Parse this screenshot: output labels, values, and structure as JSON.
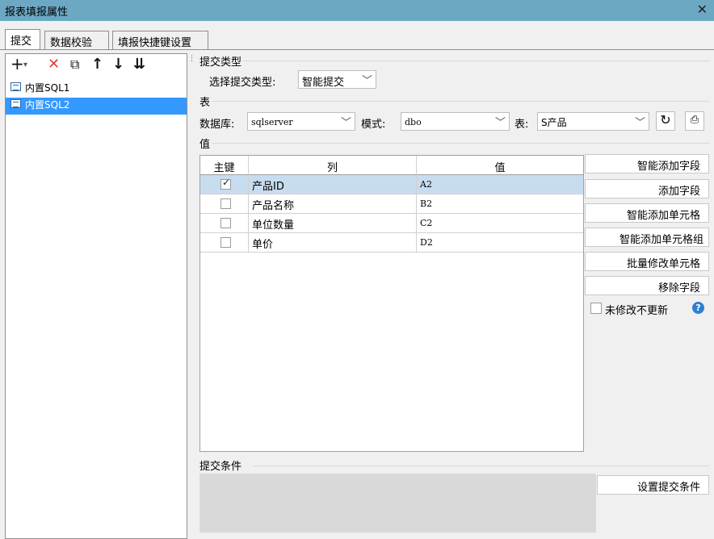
{
  "window": {
    "title": "报表填报属性",
    "close_glyph": "✕"
  },
  "tabs": [
    {
      "label": "提交"
    },
    {
      "label": "数据校验"
    },
    {
      "label": "填报快捷键设置"
    }
  ],
  "toolbar": {
    "add_glyph": "+",
    "add_dropdown_glyph": "▾",
    "delete_glyph": "✕",
    "copy_glyph": "⧉",
    "up_glyph": "↑",
    "down_glyph": "↓",
    "move_glyph": "⇊"
  },
  "tree": {
    "items": [
      {
        "label": "内置SQL1",
        "selected": false
      },
      {
        "label": "内置SQL2",
        "selected": true
      }
    ]
  },
  "submit_type": {
    "group_label": "提交类型",
    "select_label": "选择提交类型:",
    "selected": "智能提交"
  },
  "table_group": {
    "group_label": "表",
    "database_label": "数据库:",
    "database_value": "sqlserver",
    "schema_label": "模式:",
    "schema_value": "dbo",
    "table_label": "表:",
    "table_value": "S产品"
  },
  "values_group": {
    "group_label": "值",
    "columns": [
      "主键",
      "列",
      "值"
    ],
    "rows": [
      {
        "key": true,
        "column": "产品ID",
        "value": "A2",
        "selected": true
      },
      {
        "key": false,
        "column": "产品名称",
        "value": "B2",
        "selected": false
      },
      {
        "key": false,
        "column": "单位数量",
        "value": "C2",
        "selected": false
      },
      {
        "key": false,
        "column": "单价",
        "value": "D2",
        "selected": false
      }
    ]
  },
  "side_buttons": {
    "smart_add_field": "智能添加字段",
    "add_field": "添加字段",
    "smart_add_cell": "智能添加单元格",
    "smart_add_cell_group": "智能添加单元格组",
    "batch_modify_cell": "批量修改单元格",
    "remove_field": "移除字段",
    "no_update_unmodified": "未修改不更新",
    "help_glyph": "?"
  },
  "condition": {
    "group_label": "提交条件",
    "set_button": "设置提交条件"
  },
  "colors": {
    "titlebar": "#6ca8c4",
    "selection": "#3399ff",
    "row_selection": "#c8dcef",
    "delete_red": "#e03c3c",
    "help_blue": "#2f7fd0"
  }
}
